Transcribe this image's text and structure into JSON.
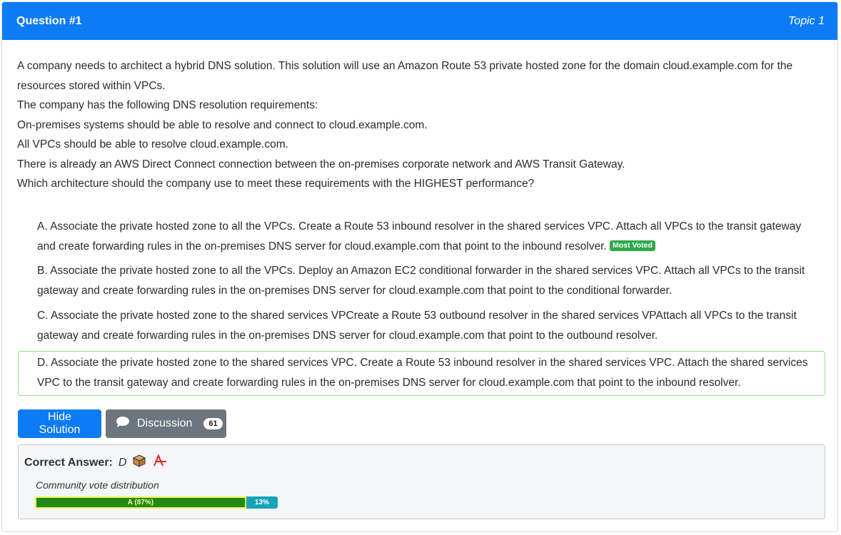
{
  "header": {
    "title": "Question #1",
    "topic": "Topic 1"
  },
  "question": {
    "paragraphs": [
      "A company needs to architect a hybrid DNS solution. This solution will use an Amazon Route 53 private hosted zone for the domain cloud.example.com for the resources stored within VPCs.",
      "The company has the following DNS resolution requirements:",
      "On-premises systems should be able to resolve and connect to cloud.example.com.",
      "All VPCs should be able to resolve cloud.example.com.",
      "There is already an AWS Direct Connect connection between the on-premises corporate network and AWS Transit Gateway.",
      "Which architecture should the company use to meet these requirements with the HIGHEST performance?"
    ]
  },
  "choices": [
    {
      "text": "A. Associate the private hosted zone to all the VPCs. Create a Route 53 inbound resolver in the shared services VPC. Attach all VPCs to the transit gateway and create forwarding rules in the on-premises DNS server for cloud.example.com that point to the inbound resolver.",
      "badge": "Most Voted"
    },
    {
      "text": "B. Associate the private hosted zone to all the VPCs. Deploy an Amazon EC2 conditional forwarder in the shared services VPC. Attach all VPCs to the transit gateway and create forwarding rules in the on-premises DNS server for cloud.example.com that point to the conditional forwarder."
    },
    {
      "text": "C. Associate the private hosted zone to the shared services VPCreate a Route 53 outbound resolver in the shared services VPAttach all VPCs to the transit gateway and create forwarding rules in the on-premises DNS server for cloud.example.com that point to the outbound resolver."
    },
    {
      "text": "D. Associate the private hosted zone to the shared services VPC. Create a Route 53 inbound resolver in the shared services VPC. Attach the shared services VPC to the transit gateway and create forwarding rules in the on-premises DNS server for cloud.example.com that point to the inbound resolver."
    }
  ],
  "buttons": {
    "hide_solution": "Hide Solution",
    "discussion": "Discussion",
    "discussion_count": "61"
  },
  "answer": {
    "label": "Correct Answer:",
    "value": "D",
    "community_label": "Community vote distribution",
    "votes": [
      {
        "label": "A (87%)",
        "percent": 87
      },
      {
        "label": "13%",
        "percent": 13
      }
    ]
  },
  "colors": {
    "header_bg": "#0d7bf4",
    "selected_border": "#92e07f",
    "vote_a": "#1f8a1a",
    "vote_b": "#17a2b8"
  }
}
